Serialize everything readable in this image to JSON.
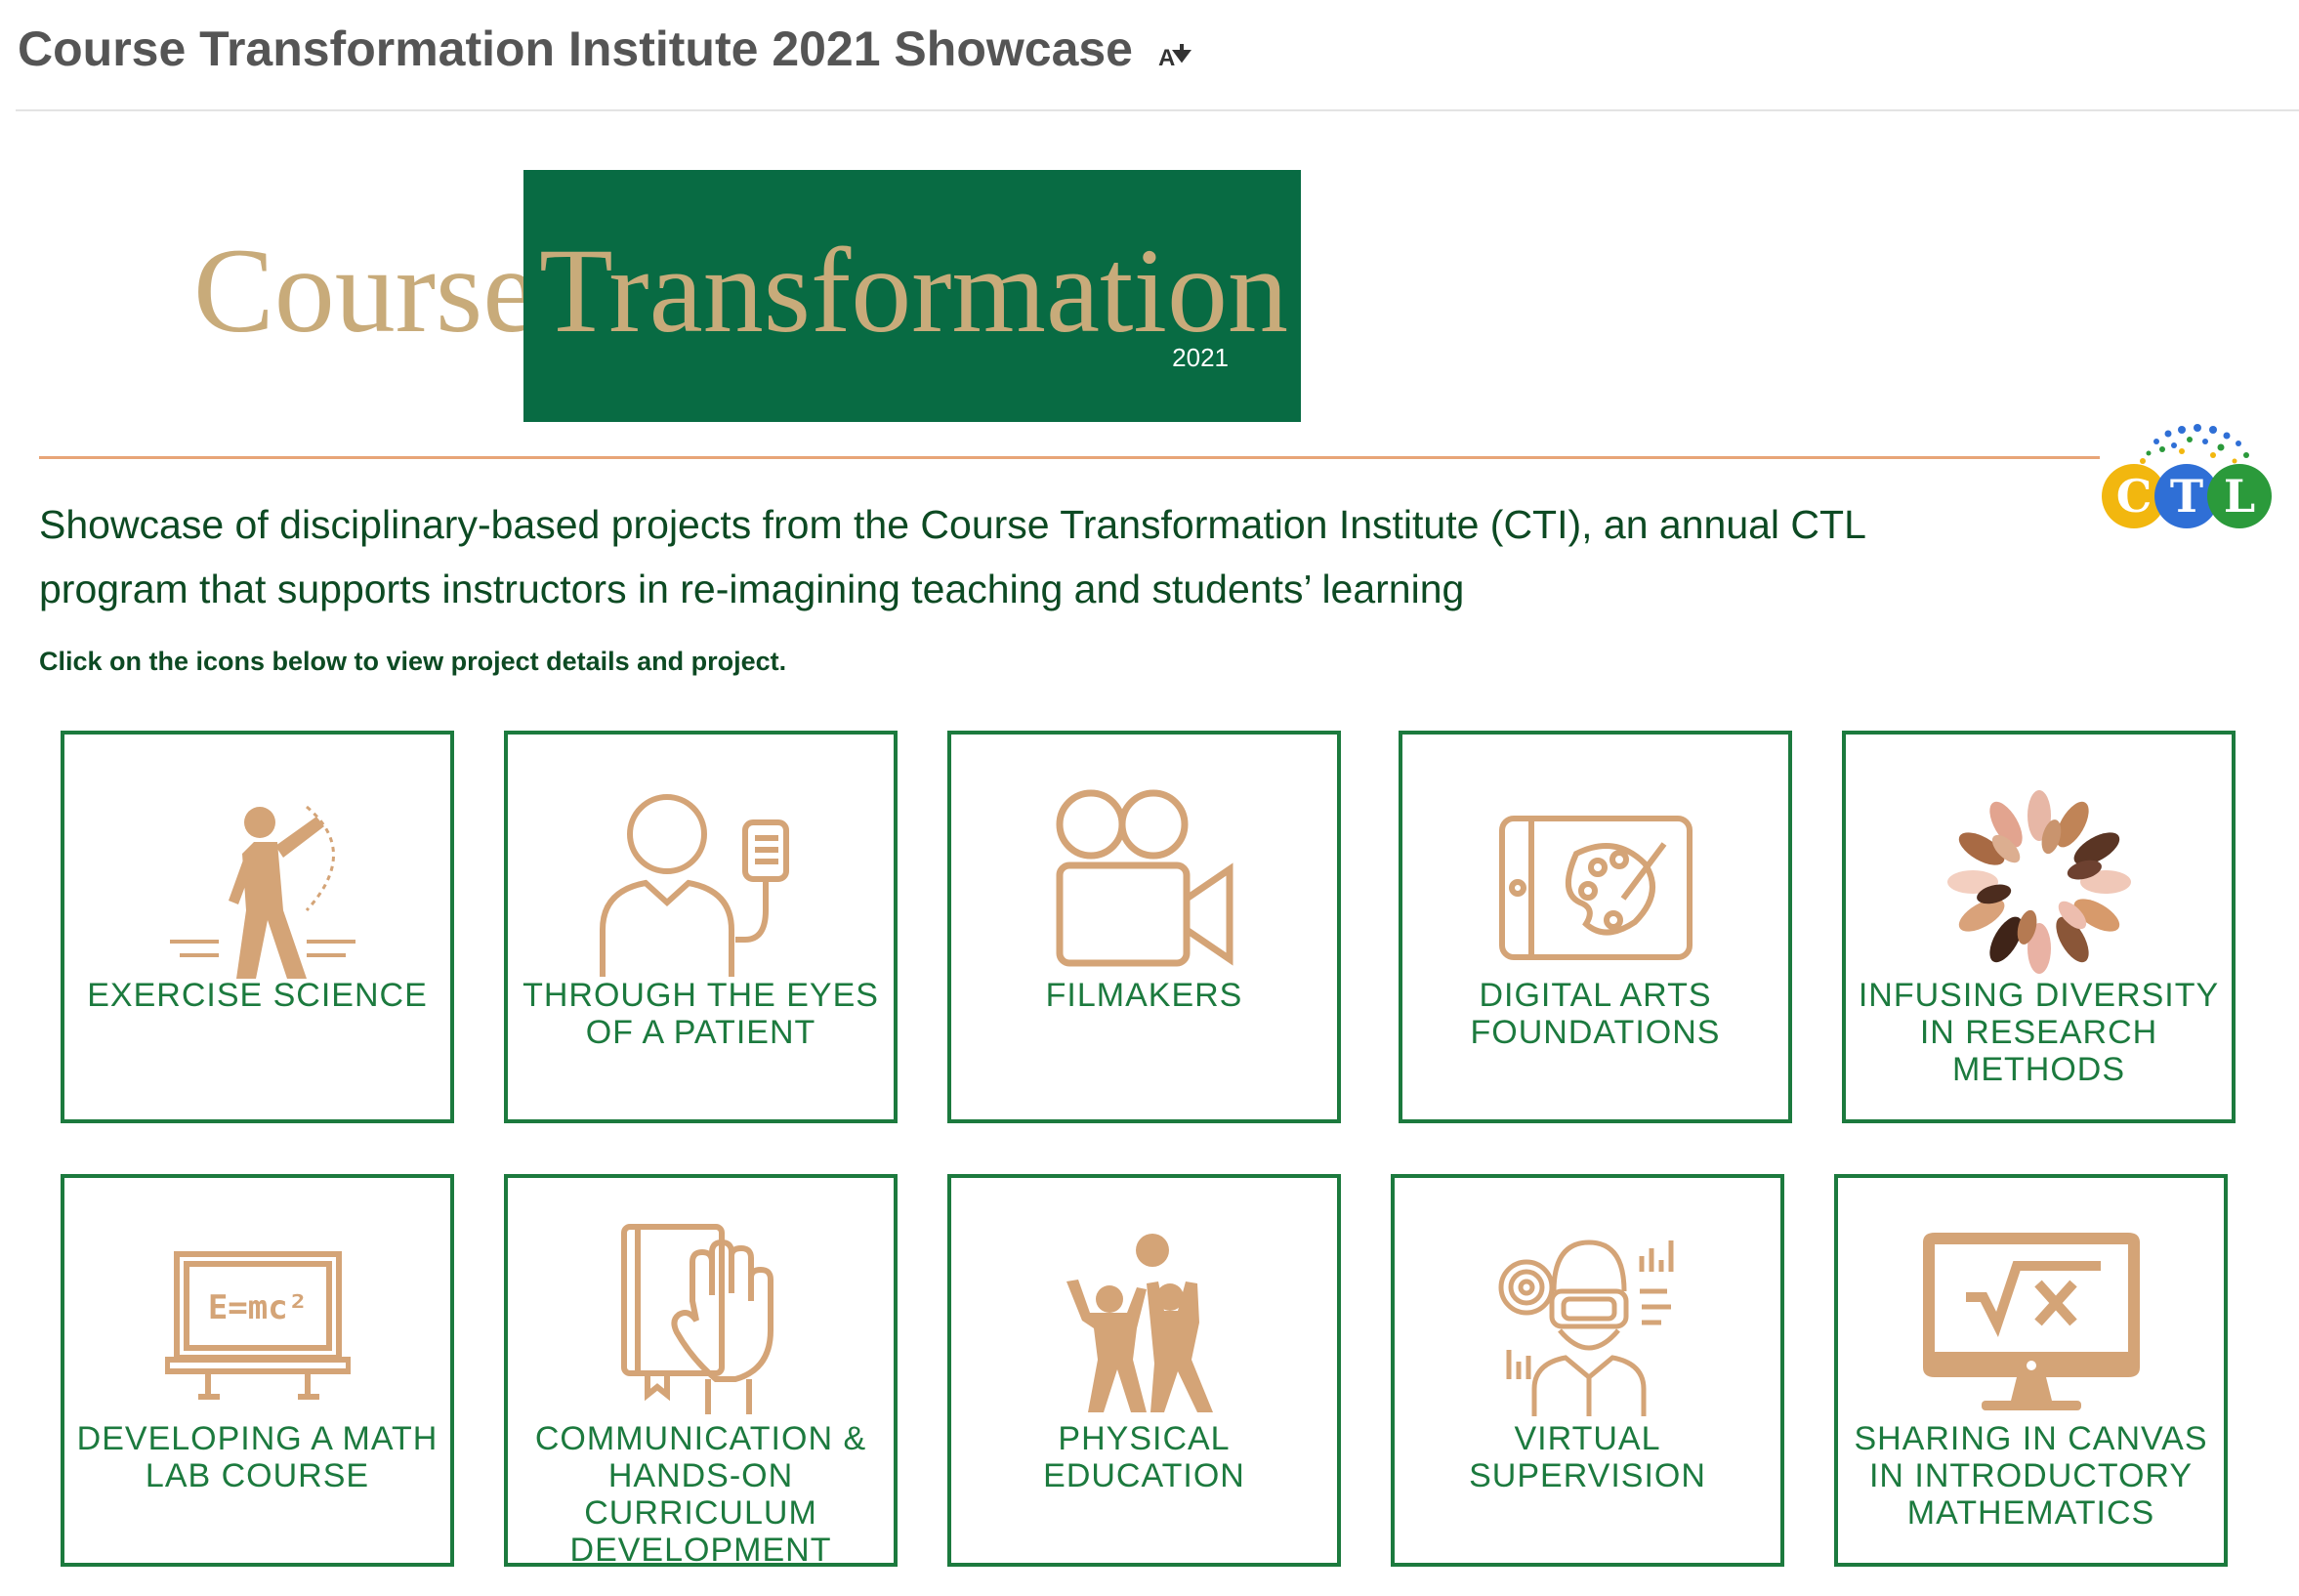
{
  "page_title": "Course Transformation Institute 2021 Showcase",
  "logo": {
    "word1": "Course",
    "word2": "Transformation",
    "year": "2021"
  },
  "ctl_logo": {
    "c": "C",
    "t": "T",
    "l": "L"
  },
  "description": "Showcase of disciplinary-based projects from the Course Transformation Institute (CTI), an annual CTL program that supports instructors in re-imagining teaching and students’ learning",
  "instruction": "Click on the icons below to view project details and project.",
  "tiles": [
    {
      "label": "EXERCISE SCIENCE",
      "icon": "exercise-icon"
    },
    {
      "label": "THROUGH THE EYES OF A PATIENT",
      "icon": "patient-icon"
    },
    {
      "label": "FILMAKERS",
      "icon": "film-camera-icon"
    },
    {
      "label": "DIGITAL ARTS FOUNDATIONS",
      "icon": "tablet-palette-icon"
    },
    {
      "label": "INFUSING DIVERSITY IN RESEARCH METHODS",
      "icon": "diverse-hands-icon"
    },
    {
      "label": "DEVELOPING A MATH LAB COURSE",
      "icon": "blackboard-icon"
    },
    {
      "label": "COMMUNICATION & HANDS-ON CURRICULUM DEVELOPMENT",
      "icon": "book-hand-icon"
    },
    {
      "label": "PHYSICAL EDUCATION",
      "icon": "kids-ball-icon"
    },
    {
      "label": "VIRTUAL SUPERVISION",
      "icon": "vr-headset-icon"
    },
    {
      "label": "SHARING IN CANVAS IN INTRODUCTORY MATHEMATICS",
      "icon": "monitor-math-icon"
    }
  ],
  "colors": {
    "tile_border": "#1c7a3e",
    "icon": "#d4a477",
    "brand_green": "#086b43",
    "accent_orange": "#e8a577"
  }
}
